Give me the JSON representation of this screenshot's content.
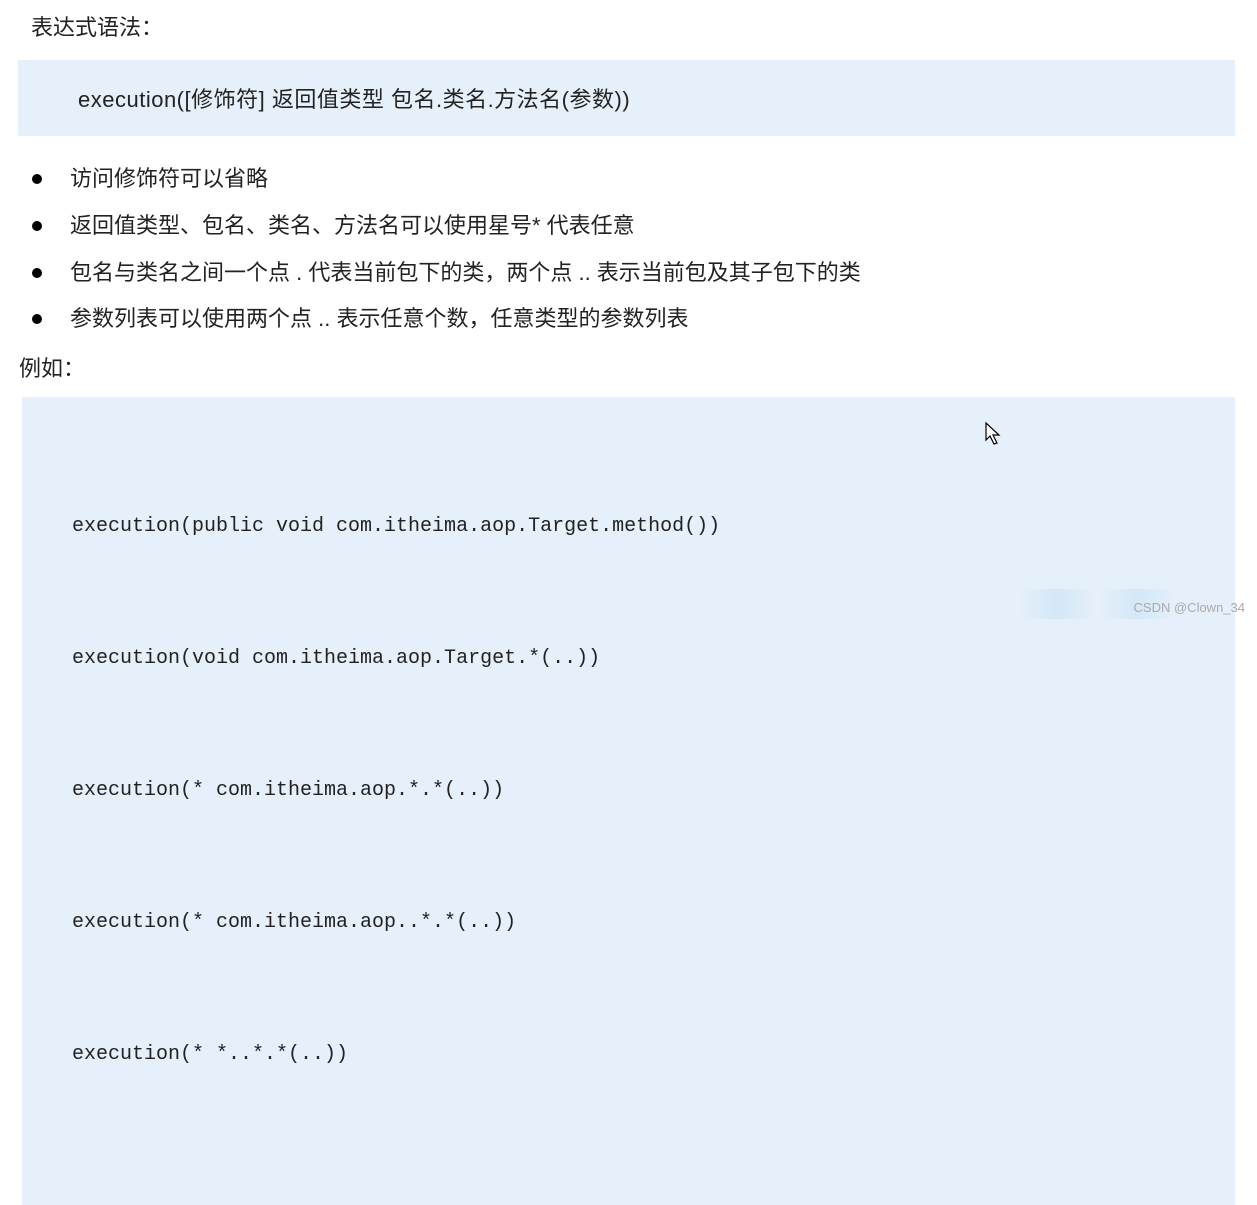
{
  "title": "表达式语法：",
  "syntax_box": "execution([修饰符] 返回值类型 包名.类名.方法名(参数))",
  "bullets": [
    "访问修饰符可以省略",
    "返回值类型、包名、类名、方法名可以使用星号* 代表任意",
    "包名与类名之间一个点 . 代表当前包下的类，两个点 .. 表示当前包及其子包下的类",
    "参数列表可以使用两个点 .. 表示任意个数，任意类型的参数列表"
  ],
  "example_label": "例如：",
  "code_examples": [
    "execution(public void com.itheima.aop.Target.method())",
    "execution(void com.itheima.aop.Target.*(..))",
    "execution(* com.itheima.aop.*.*(..))",
    "execution(* com.itheima.aop..*.*(..))",
    "execution(* *..*.*(..))"
  ],
  "watermark": "CSDN @Clown_34"
}
